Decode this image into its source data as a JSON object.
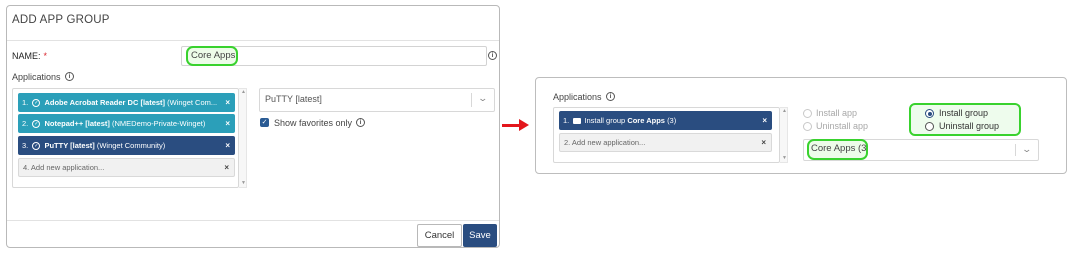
{
  "dialog": {
    "title": "ADD APP GROUP",
    "name_label": "NAME:",
    "required_mark": "*",
    "name_value": "Core Apps",
    "applications_label": "Applications",
    "apps": [
      {
        "index": "1.",
        "name": "Adobe Acrobat Reader DC [latest]",
        "source": "(Winget Com..."
      },
      {
        "index": "2.",
        "name": "Notepad++ [latest]",
        "source": "(NMEDemo-Private-Winget)"
      },
      {
        "index": "3.",
        "name": "PuTTY [latest]",
        "source": "(Winget Community)"
      }
    ],
    "add_new_placeholder": "4. Add new application...",
    "remove_symbol": "×",
    "selected_app": "PuTTY [latest]",
    "show_favorites_label": "Show favorites only",
    "cancel_label": "Cancel",
    "save_label": "Save"
  },
  "panel": {
    "applications_label": "Applications",
    "group_item": {
      "index": "1.",
      "prefix": "Install group",
      "name": "Core Apps",
      "count": "(3)"
    },
    "add_new_placeholder": "2. Add new application...",
    "remove_symbol": "×",
    "install_app_label": "Install app",
    "uninstall_app_label": "Uninstall app",
    "install_group_label": "Install group",
    "uninstall_group_label": "Uninstall group",
    "group_select_value": "Core Apps (3)"
  },
  "icons": {
    "info": "i",
    "check": "✓",
    "chevron": "⌄"
  },
  "colors": {
    "highlight_green": "#39d22e",
    "chip_teal": "#2b9fb9",
    "chip_navy": "#2a4d80",
    "primary_button": "#2a4d80",
    "arrow_red": "#e3161c",
    "required_red": "#d9232d"
  }
}
